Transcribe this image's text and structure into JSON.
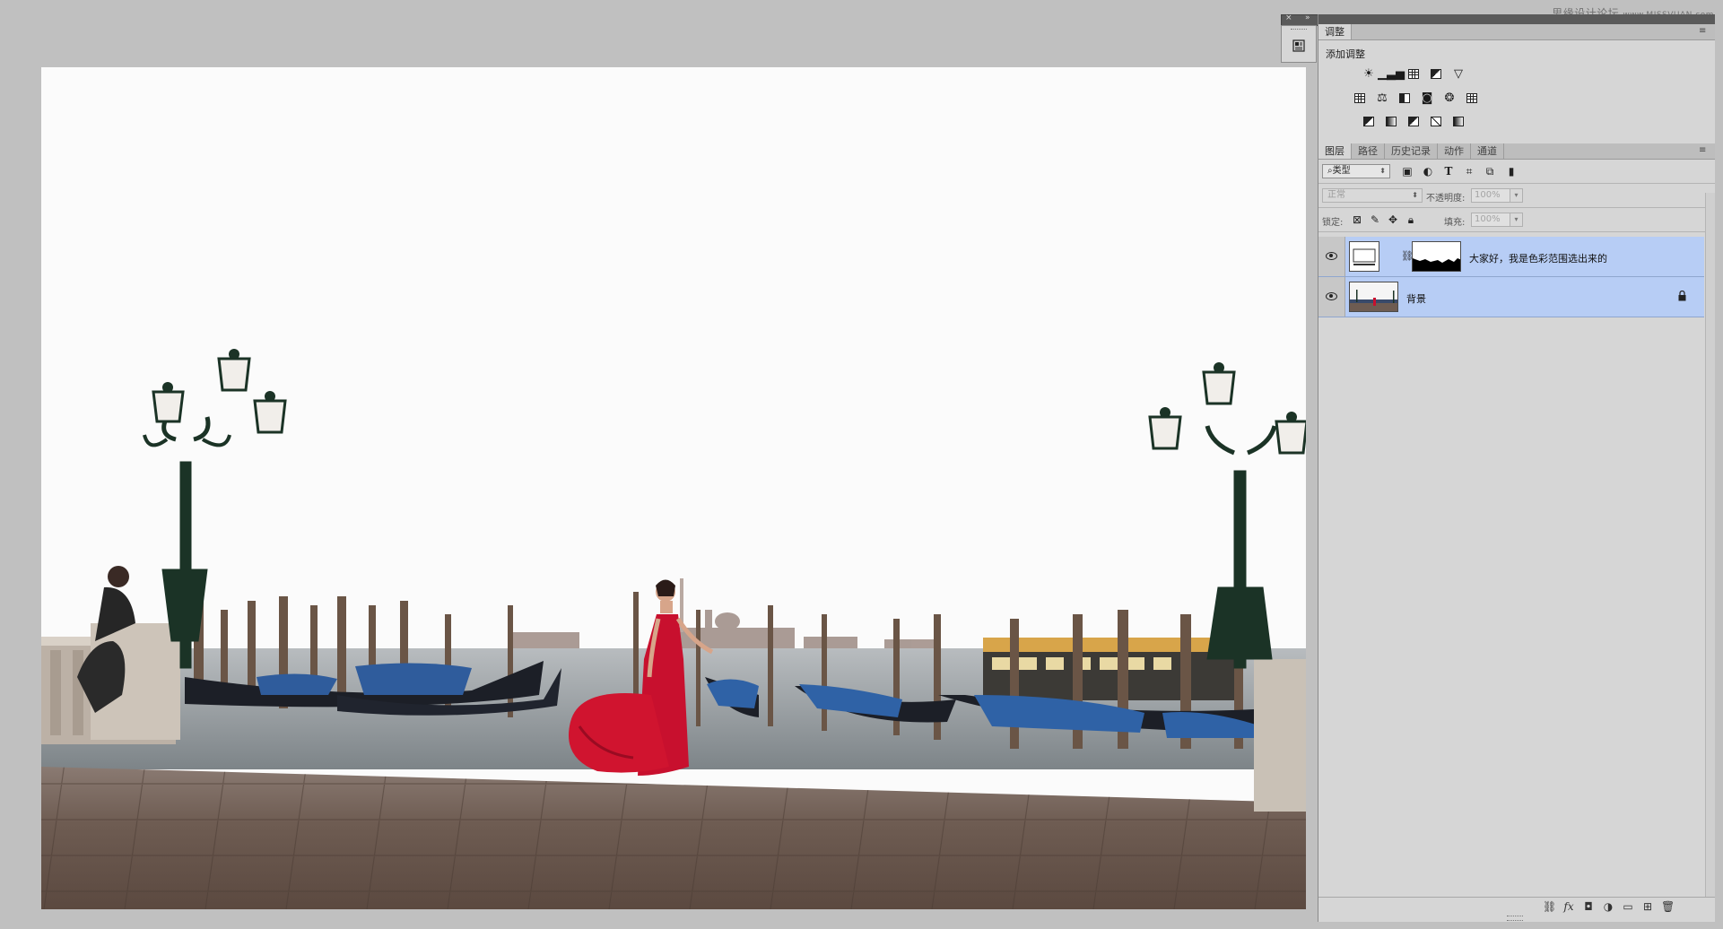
{
  "watermark": {
    "text": "思缘设计论坛",
    "site": "www.MISSVUAN.com"
  },
  "adjustments_panel": {
    "tab_label": "调整",
    "title": "添加调整",
    "rows": [
      [
        "brightness-contrast-icon",
        "levels-icon",
        "curves-icon",
        "exposure-icon",
        "vibrance-icon"
      ],
      [
        "hue-saturation-icon",
        "color-balance-icon",
        "black-white-icon",
        "photo-filter-icon",
        "channel-mixer-icon",
        "color-lookup-icon"
      ],
      [
        "invert-icon",
        "posterize-icon",
        "threshold-icon",
        "selective-color-icon",
        "gradient-map-icon"
      ]
    ]
  },
  "layers_panel": {
    "tabs": [
      "图层",
      "路径",
      "历史记录",
      "动作",
      "通道"
    ],
    "active_tab": "图层",
    "filter": {
      "kind_label": "类型"
    },
    "blend_mode": "正常",
    "opacity_label": "不透明度:",
    "opacity_value": "100%",
    "lock_label": "锁定:",
    "fill_label": "填充:",
    "fill_value": "100%",
    "layers": [
      {
        "name": "大家好，我是色彩范围选出来的",
        "visible": true,
        "has_mask": true,
        "locked": false
      },
      {
        "name": "背景",
        "visible": true,
        "has_mask": false,
        "locked": true
      }
    ],
    "bottom_icons": [
      "link-layers-icon",
      "fx-icon",
      "add-mask-icon",
      "adjustment-layer-icon",
      "group-icon",
      "new-layer-icon",
      "trash-icon"
    ]
  },
  "colors": {
    "workspace": "#c0c0c0",
    "panel": "#d6d6d6",
    "selected_layer": "#b7cdf5",
    "dress_red": "#c8102e"
  }
}
